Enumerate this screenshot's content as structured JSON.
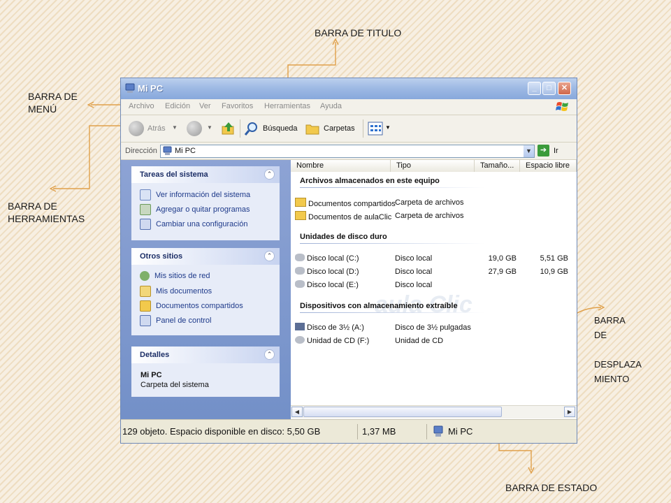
{
  "labels": {
    "title_bar": "BARRA DE TITULO",
    "menu_bar": [
      "BARRA DE",
      "MENÚ"
    ],
    "tool_bar": [
      "BARRA DE",
      "HERRAMIENTAS"
    ],
    "scroll_bar": [
      "BARRA",
      "DE",
      "DESPLAZA",
      "MIENTO"
    ],
    "status_bar": "BARRA DE ESTADO"
  },
  "window": {
    "title": "Mi PC",
    "controls": [
      "minimize",
      "maximize",
      "close"
    ],
    "menu": [
      "Archivo",
      "Edición",
      "Ver",
      "Favoritos",
      "Herramientas",
      "Ayuda"
    ],
    "toolbar": {
      "back": "Atrás",
      "search": "Búsqueda",
      "folders": "Carpetas"
    },
    "address": {
      "label": "Dirección",
      "value": "Mi PC",
      "go": "Ir"
    },
    "left_pane": {
      "system_tasks": {
        "title": "Tareas del sistema",
        "items": [
          "Ver información del sistema",
          "Agregar o quitar programas",
          "Cambiar una configuración"
        ]
      },
      "other_places": {
        "title": "Otros sitios",
        "items": [
          "Mis sitios de red",
          "Mis documentos",
          "Documentos compartidos",
          "Panel de control"
        ]
      },
      "details": {
        "title": "Detalles",
        "name": "Mi PC",
        "description": "Carpeta del sistema"
      }
    },
    "columns": [
      "Nombre",
      "Tipo",
      "Tamaño...",
      "Espacio libre"
    ],
    "groups": [
      {
        "title": "Archivos almacenados en este equipo",
        "items": [
          {
            "name": "Documentos compartidos",
            "type": "Carpeta de archivos",
            "size": "",
            "free": ""
          },
          {
            "name": "Documentos de aulaClic",
            "type": "Carpeta de archivos",
            "size": "",
            "free": ""
          }
        ]
      },
      {
        "title": "Unidades de disco duro",
        "items": [
          {
            "name": "Disco local (C:)",
            "type": "Disco local",
            "size": "19,0 GB",
            "free": "5,51 GB"
          },
          {
            "name": "Disco local (D:)",
            "type": "Disco local",
            "size": "27,9 GB",
            "free": "10,9 GB"
          },
          {
            "name": "Disco local (E:)",
            "type": "Disco local",
            "size": "",
            "free": ""
          }
        ]
      },
      {
        "title": "Dispositivos con almacenamiento extraíble",
        "items": [
          {
            "name": "Disco de 3½ (A:)",
            "type": "Disco de 3½ pulgadas",
            "size": "",
            "free": ""
          },
          {
            "name": "Unidad de CD (F:)",
            "type": "Unidad de CD",
            "size": "",
            "free": ""
          }
        ]
      }
    ],
    "watermark": "aula Clic",
    "status": {
      "objects": "129 objeto. Espacio disponible en disco: 5,50 GB",
      "size": "1,37 MB",
      "location": "Mi PC"
    }
  },
  "colors": {
    "arrow": "#e0a04a",
    "title_gradient": "#9fbae4",
    "left_pane": "#7390c8"
  }
}
